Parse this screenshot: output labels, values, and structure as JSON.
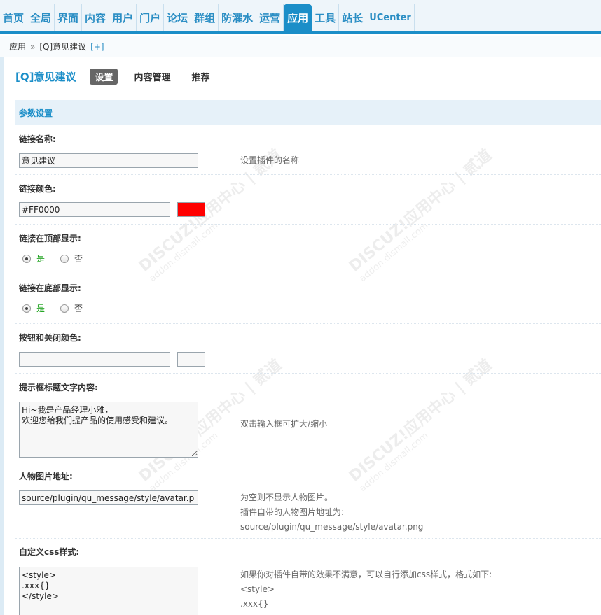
{
  "nav": {
    "items": [
      "首页",
      "全局",
      "界面",
      "内容",
      "用户",
      "门户",
      "论坛",
      "群组",
      "防灌水",
      "运营",
      "应用",
      "工具",
      "站长",
      "UCenter"
    ],
    "active_index": 10
  },
  "breadcrumb": {
    "parent": "应用",
    "separator": "»",
    "current": "[Q]意见建议",
    "add": "[+]"
  },
  "plugin": {
    "title": "[Q]意见建议",
    "tabs": [
      "设置",
      "内容管理",
      "推荐"
    ],
    "active_tab": 0
  },
  "section": {
    "title": "参数设置"
  },
  "settings": {
    "link_name": {
      "label": "链接名称:",
      "value": "意见建议",
      "tip": "设置插件的名称"
    },
    "link_color": {
      "label": "链接颜色:",
      "value": "#FF0000",
      "swatch": "#ff0000"
    },
    "show_top": {
      "label": "链接在顶部显示:",
      "yes": "是",
      "no": "否",
      "selected": "yes"
    },
    "show_bottom": {
      "label": "链接在底部显示:",
      "yes": "是",
      "no": "否",
      "selected": "yes"
    },
    "button_color": {
      "label": "按钮和关闭颜色:",
      "value": "",
      "swatch": "#f7f7f7"
    },
    "prompt_title": {
      "label": "提示框标题文字内容:",
      "value": "Hi~我是产品经理小雅，\n欢迎您给我们提产品的使用感受和建议。",
      "tip": "双击输入框可扩大/缩小"
    },
    "avatar_url": {
      "label": "人物图片地址:",
      "value": "source/plugin/qu_message/style/avatar.p",
      "tip": "为空则不显示人物图片。\n插件自带的人物图片地址为:\nsource/plugin/qu_message/style/avatar.png"
    },
    "custom_css": {
      "label": "自定义css样式:",
      "value": "<style>\n.xxx{}\n</style>",
      "tip": "如果你对插件自带的效果不满意，可以自行添加css样式，格式如下:\n<style>\n.xxx{}"
    }
  },
  "watermark": {
    "brand": "DISCUZ!应用中心 | 贰道",
    "domain": "addon.dismall.com"
  },
  "colors": {
    "accent": "#1b8ec8",
    "section_bg": "#e6f1f9",
    "yes_color": "#0a9a0a"
  }
}
